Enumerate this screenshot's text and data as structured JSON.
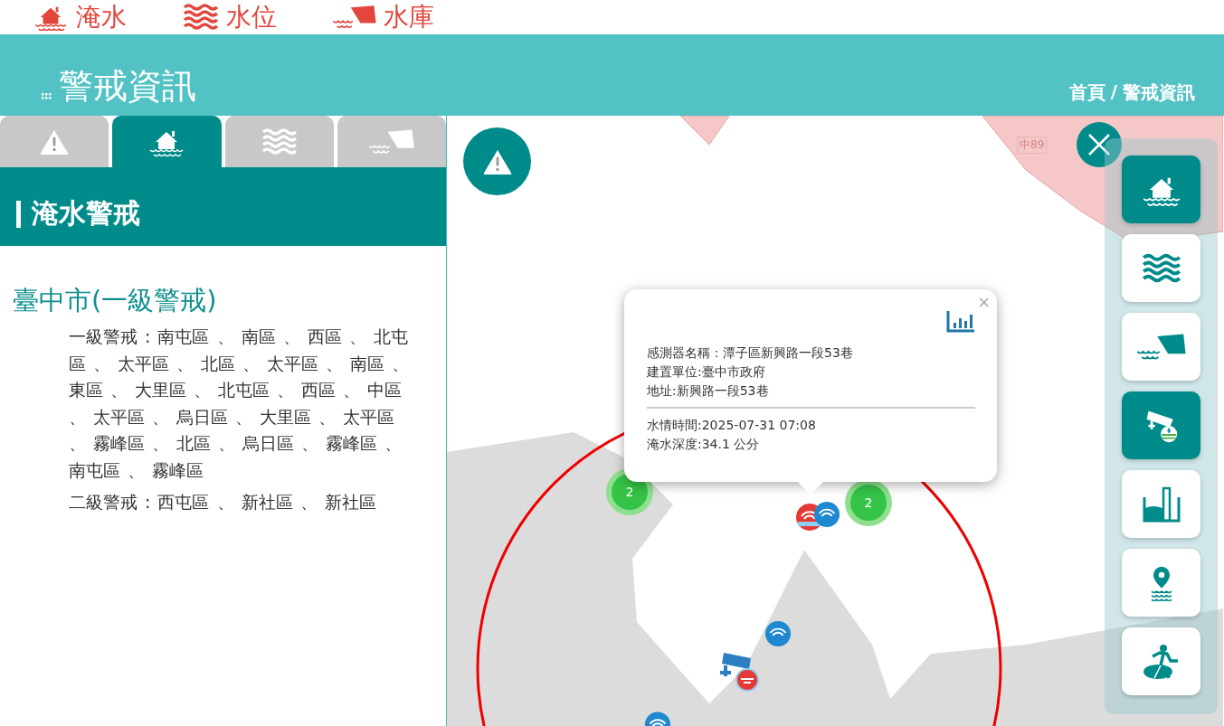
{
  "top_nav": [
    {
      "label": "淹水",
      "kind": "flood"
    },
    {
      "label": "水位",
      "kind": "level"
    },
    {
      "label": "水庫",
      "kind": "reservoir"
    }
  ],
  "header": {
    "title": "警戒資訊",
    "breadcrumb": [
      {
        "label": "首頁"
      },
      {
        "label": "警戒資訊"
      }
    ],
    "separator": "/"
  },
  "tabs": [
    {
      "kind": "alert",
      "selected": false
    },
    {
      "kind": "flood",
      "selected": true
    },
    {
      "kind": "level",
      "selected": false
    },
    {
      "kind": "reservoir",
      "selected": false
    }
  ],
  "panel": {
    "heading": "淹水警戒",
    "city": "臺中市(一級警戒)",
    "alerts": [
      {
        "lines": [
          "一級警戒 : 南屯區 、 南區 、 西區 、 北屯",
          "區 、 太平區 、 北區 、 太平區 、 南區 、",
          "東區 、 大里區 、 北屯區 、 西區 、 中區",
          "、 太平區 、 烏日區 、 大里區 、 太平區",
          "、 霧峰區 、 北區 、 烏日區 、 霧峰區 、",
          "南屯區 、 霧峰區"
        ]
      },
      {
        "lines": [
          "二級警戒 : 西屯區 、 新社區 、 新社區"
        ]
      }
    ]
  },
  "map": {
    "road_label": "中89",
    "clusters": [
      {
        "count": "2"
      },
      {
        "count": "2"
      }
    ],
    "popup": {
      "close": "×",
      "info": [
        "感測器名稱：潭子區新興路一段53巷",
        "建置單位:臺中市政府",
        "地址:新興路一段53巷"
      ],
      "readings": [
        "水情時間:2025-07-31 07:08",
        "淹水深度:34.1 公分"
      ]
    }
  },
  "layer_buttons": [
    {
      "kind": "flood",
      "selected": true
    },
    {
      "kind": "level",
      "selected": false
    },
    {
      "kind": "reservoir",
      "selected": false
    },
    {
      "kind": "camera",
      "selected": true
    },
    {
      "kind": "gauge",
      "selected": false
    },
    {
      "kind": "location",
      "selected": false
    },
    {
      "kind": "evacuation",
      "selected": false
    }
  ]
}
